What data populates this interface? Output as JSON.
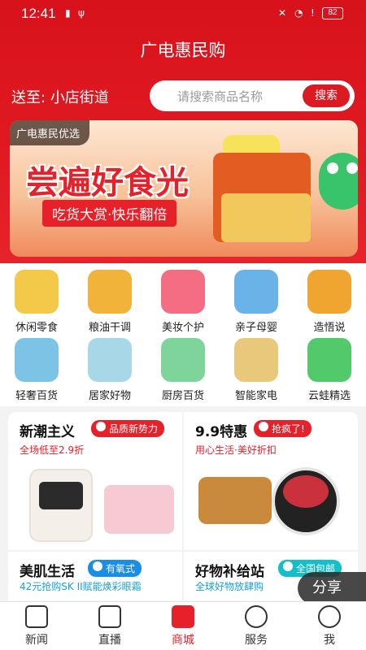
{
  "status_bar": {
    "time": "12:41",
    "battery": "82"
  },
  "header": {
    "title": "广电惠民购"
  },
  "location": {
    "label": "送至:",
    "value": "小店街道"
  },
  "search": {
    "placeholder": "请搜索商品名称",
    "button": "搜索"
  },
  "banner": {
    "tag": "广电惠民优选",
    "headline": "尝遍好食光",
    "subline": "吃货大赏·快乐翻倍"
  },
  "categories": [
    {
      "label": "休闲零食",
      "icon": "snack-icon",
      "color": "#f3c94a"
    },
    {
      "label": "粮油干调",
      "icon": "oil-bottle-icon",
      "color": "#f2b33a"
    },
    {
      "label": "美妆个护",
      "icon": "cosmetics-icon",
      "color": "#f56d82"
    },
    {
      "label": "亲子母婴",
      "icon": "baby-formula-icon",
      "color": "#6ab3e8"
    },
    {
      "label": "造悟说",
      "icon": "book-icon",
      "color": "#f0a531"
    },
    {
      "label": "轻奢百货",
      "icon": "watch-icon",
      "color": "#7cc3e6"
    },
    {
      "label": "居家好物",
      "icon": "fan-icon",
      "color": "#a8d8e8"
    },
    {
      "label": "厨房百货",
      "icon": "cleaner-icon",
      "color": "#7fd49b"
    },
    {
      "label": "智能家电",
      "icon": "kettle-icon",
      "color": "#e8c87a"
    },
    {
      "label": "云蛙精选",
      "icon": "frog-icon",
      "color": "#52c96b"
    }
  ],
  "promos": [
    {
      "title": "新潮主义",
      "badge": "品质新势力",
      "subtitle": "全场低至2.9折"
    },
    {
      "title": "9.9特惠",
      "badge": "抢疯了!",
      "subtitle": "用心生活·美好折扣"
    },
    {
      "title": "美肌生活",
      "badge": "有氧式",
      "subtitle": "42元抢购SK II赋能焕彩眼霜"
    },
    {
      "title": "好物补给站",
      "badge": "全国包邮",
      "subtitle": "全球好物放肆购"
    }
  ],
  "share": {
    "label": "分享"
  },
  "nav": [
    {
      "label": "新闻",
      "icon": "news-icon"
    },
    {
      "label": "直播",
      "icon": "live-icon"
    },
    {
      "label": "商城",
      "icon": "store-icon"
    },
    {
      "label": "服务",
      "icon": "heart-icon"
    },
    {
      "label": "我",
      "icon": "profile-icon"
    }
  ],
  "colors": {
    "brand": "#e6212a",
    "accent_blue": "#1a8ee6"
  }
}
